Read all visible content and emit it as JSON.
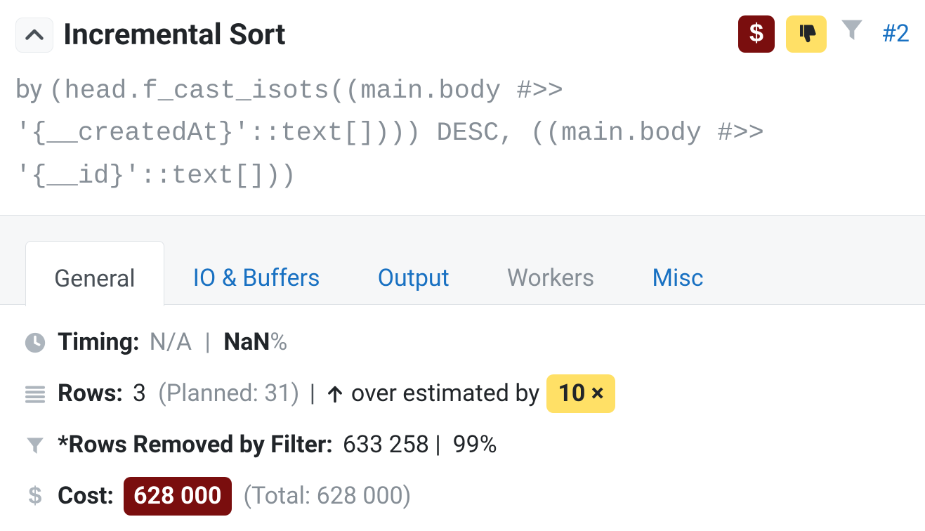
{
  "header": {
    "title": "Incremental Sort",
    "node_link": "#2"
  },
  "sort": {
    "by_label": "by",
    "expression": "(head.f_cast_isots((main.body #>> '{__createdAt}'::text[]))) DESC, ((main.body #>> '{__id}'::text[]))"
  },
  "tabs": [
    {
      "id": "general",
      "label": "General",
      "active": true,
      "link": false
    },
    {
      "id": "io",
      "label": "IO & Buffers",
      "active": false,
      "link": true
    },
    {
      "id": "output",
      "label": "Output",
      "active": false,
      "link": true
    },
    {
      "id": "workers",
      "label": "Workers",
      "active": false,
      "link": false
    },
    {
      "id": "misc",
      "label": "Misc",
      "active": false,
      "link": true
    }
  ],
  "stats": {
    "timing": {
      "label": "Timing:",
      "value": "N/A",
      "pct_bold": "NaN",
      "pct_suffix": "%"
    },
    "rows": {
      "label": "Rows:",
      "actual": "3",
      "planned_label": "(Planned: 31)",
      "over_text": "over estimated by",
      "factor": "10 ×"
    },
    "removed": {
      "label": "*Rows Removed by Filter:",
      "value": "633 258",
      "pct": "99%"
    },
    "cost": {
      "label": "Cost:",
      "value": "628 000",
      "total_label": "(Total: 628 000)"
    }
  }
}
